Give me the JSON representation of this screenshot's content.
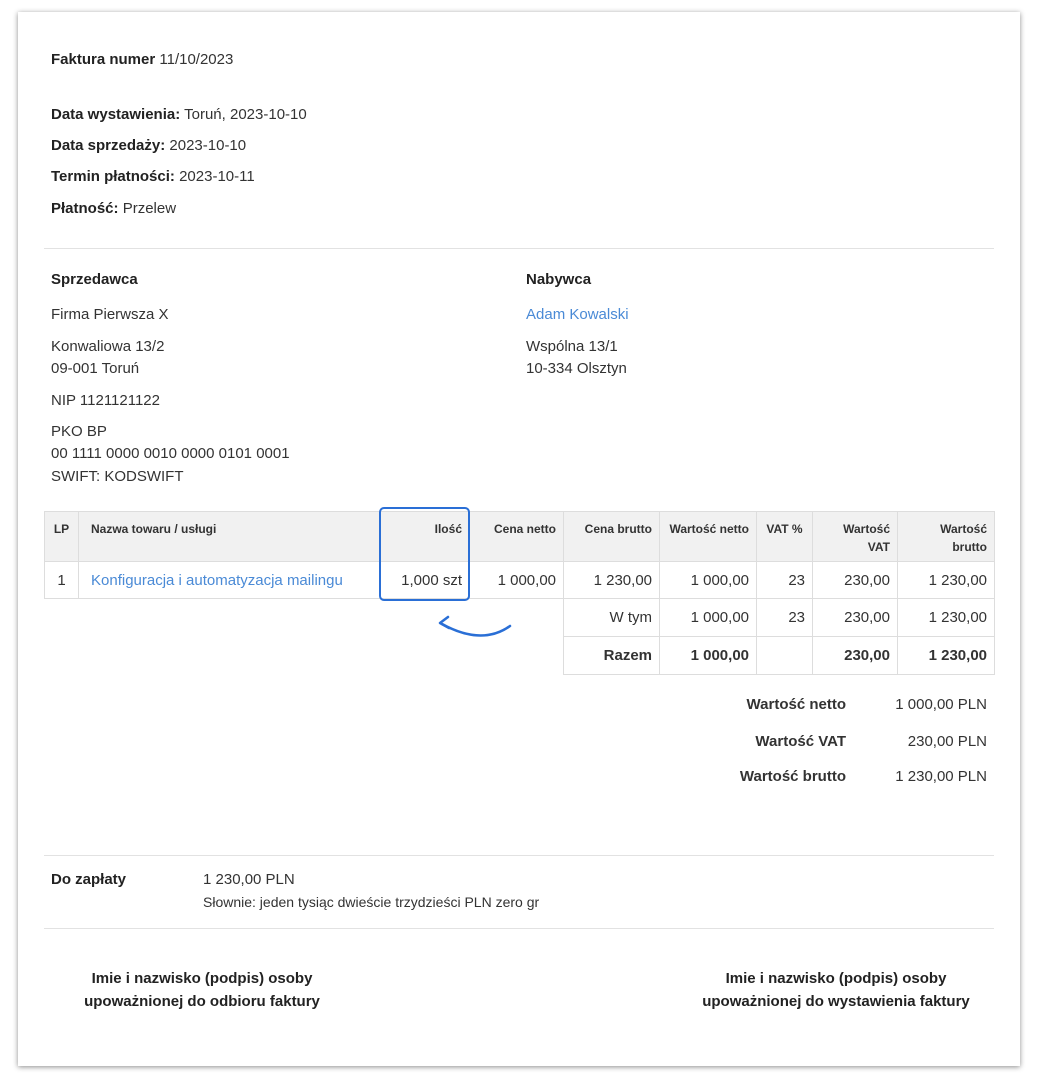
{
  "invoice": {
    "number_label": "Faktura numer",
    "number": "11/10/2023"
  },
  "meta": [
    {
      "label": "Data wystawienia:",
      "value": "Toruń, 2023-10-10"
    },
    {
      "label": "Data sprzedaży:",
      "value": "2023-10-10"
    },
    {
      "label": "Termin płatności:",
      "value": "2023-10-11"
    },
    {
      "label": "Płatność:",
      "value": "Przelew"
    }
  ],
  "seller": {
    "heading": "Sprzedawca",
    "name": "Firma Pierwsza X",
    "street": "Konwaliowa 13/2",
    "city": "09-001 Toruń",
    "nip": "NIP 1121121122",
    "bank": "PKO BP",
    "account": "00 1111 0000 0010 0000 0101 0001",
    "swift": "SWIFT: KODSWIFT"
  },
  "buyer": {
    "heading": "Nabywca",
    "name": "Adam Kowalski",
    "street": "Wspólna 13/1",
    "city": "10-334 Olsztyn"
  },
  "table": {
    "headers": [
      "LP",
      "Nazwa towaru / usługi",
      "Ilość",
      "Cena netto",
      "Cena brutto",
      "Wartość netto",
      "VAT %",
      "Wartość VAT",
      "Wartość brutto"
    ],
    "row": {
      "lp": "1",
      "name": "Konfiguracja i automatyzacja mailingu",
      "qty": "1,000 szt",
      "net_price": "1 000,00",
      "gross_price": "1 230,00",
      "net_value": "1 000,00",
      "vat": "23",
      "vat_value": "230,00",
      "gross_value": "1 230,00"
    },
    "wtym": {
      "label": "W tym",
      "net": "1 000,00",
      "vat": "23",
      "vat_value": "230,00",
      "gross": "1 230,00"
    },
    "razem": {
      "label": "Razem",
      "net": "1 000,00",
      "vat_value": "230,00",
      "gross": "1 230,00"
    }
  },
  "totals": [
    {
      "label": "Wartość netto",
      "value": "1 000,00 PLN"
    },
    {
      "label": "Wartość VAT",
      "value": "230,00 PLN"
    },
    {
      "label": "Wartość brutto",
      "value": "1 230,00 PLN"
    }
  ],
  "payment": {
    "label": "Do zapłaty",
    "amount": "1 230,00 PLN",
    "words": "Słownie: jeden tysiąc dwieście trzydzieści PLN zero gr"
  },
  "signatures": {
    "left_1": "Imie i nazwisko (podpis) osoby",
    "left_2": "upoważnionej do odbioru faktury",
    "right_1": "Imie i nazwisko (podpis) osoby",
    "right_2": "upoważnionej do wystawienia faktury"
  },
  "highlight_color": "#2a6fd6"
}
